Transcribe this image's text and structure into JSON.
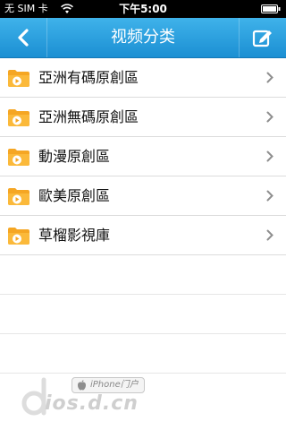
{
  "status_bar": {
    "carrier": "无 SIM 卡",
    "time": "下午5:00"
  },
  "nav": {
    "title": "视频分类",
    "back_icon": "chevron-left-icon",
    "edit_icon": "edit-icon"
  },
  "categories": [
    {
      "label": "亞洲有碼原創區"
    },
    {
      "label": "亞洲無碼原創區"
    },
    {
      "label": "動漫原創區"
    },
    {
      "label": "歐美原創區"
    },
    {
      "label": "草榴影視庫"
    }
  ],
  "watermark": {
    "badge": "iPhone门户",
    "site": "ios.d.cn"
  },
  "colors": {
    "nav_top": "#3fb2ea",
    "nav_bottom": "#1b8fd3",
    "folder": "#f5a623",
    "separator": "#dcdcdc"
  }
}
